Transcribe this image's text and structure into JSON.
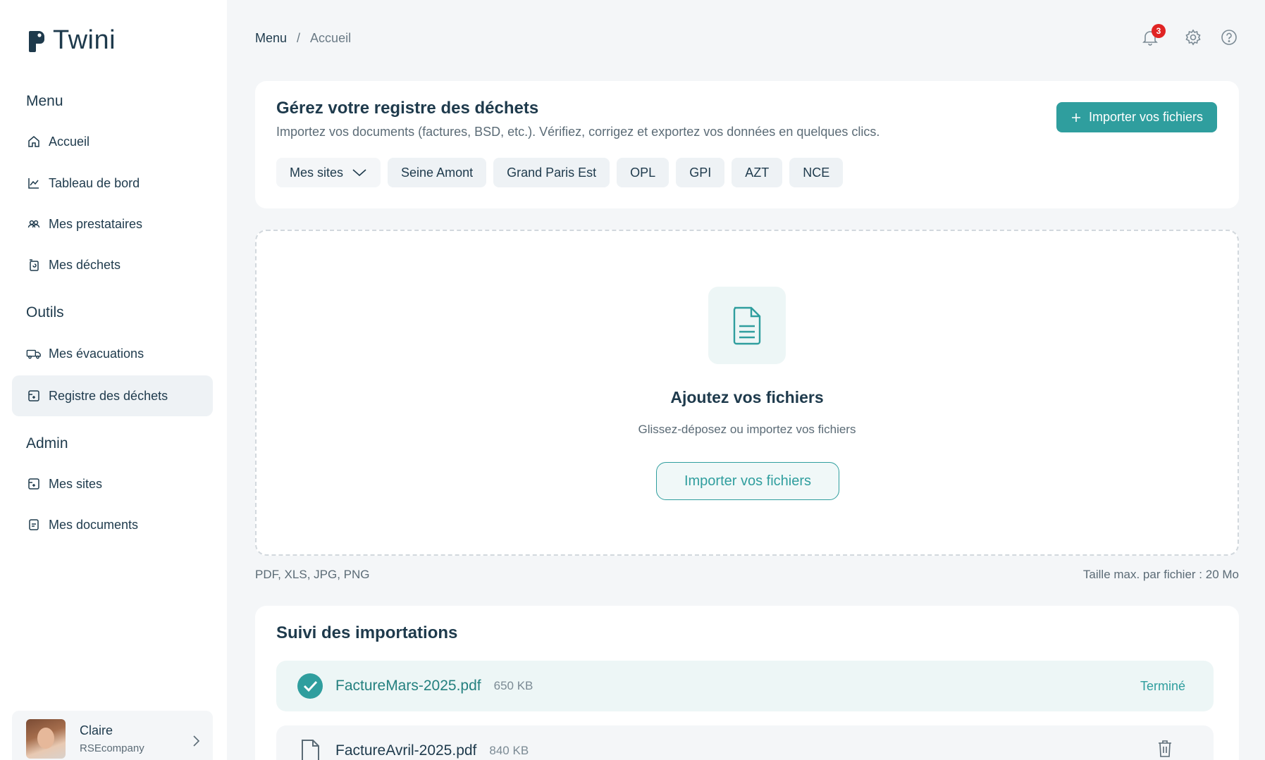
{
  "sidebar": {
    "brand": "Twini",
    "sections": {
      "menu": "Menu",
      "outils": "Outils",
      "admin": "Admin"
    },
    "items": [
      {
        "label": "Accueil",
        "icon": "home-icon"
      },
      {
        "label": "Tableau de bord",
        "icon": "chart-icon"
      },
      {
        "label": "Mes prestataires",
        "icon": "users-icon"
      },
      {
        "label": "Mes déchets",
        "icon": "recycle-icon"
      },
      {
        "label": "Mes évacuations",
        "icon": "truck-icon"
      },
      {
        "label": "Registre des déchets",
        "icon": "register-icon",
        "active": true
      },
      {
        "label": "Mes sites",
        "icon": "site-icon"
      },
      {
        "label": "Mes documents",
        "icon": "document-icon"
      }
    ],
    "user": {
      "name": "Claire",
      "company": "RSEcompany"
    }
  },
  "topbar": {
    "breadcrumb": {
      "root": "Menu",
      "separator": "/",
      "current": "Accueil"
    },
    "notifications_count": "3"
  },
  "header": {
    "title": "Gérez votre registre des déchets",
    "subtitle": "Importez vos documents (factures, BSD, etc.). Vérifiez, corrigez et exportez vos données en quelques clics.",
    "import_button": "Importer vos fichiers",
    "sites_dropdown": "Mes sites",
    "sites": [
      "Seine Amont",
      "Grand Paris Est",
      "OPL",
      "GPI",
      "AZT",
      "NCE"
    ]
  },
  "dropzone": {
    "title": "Ajoutez vos fichiers",
    "subtitle": "Glissez-déposez ou importez vos fichiers",
    "button": "Importer vos fichiers",
    "formats": "PDF, XLS, JPG, PNG",
    "max_size": "Taille max. par fichier : 20 Mo"
  },
  "imports": {
    "title": "Suivi des importations",
    "rows": [
      {
        "name": "FactureMars-2025.pdf",
        "size": "650 KB",
        "status": "Terminé"
      },
      {
        "name": "FactureAvril-2025.pdf",
        "size": "840 KB",
        "status": ""
      }
    ]
  },
  "colors": {
    "accent": "#2f9e9e",
    "text": "#1e3a4c",
    "muted": "#5b6b76",
    "badge": "#e02424"
  }
}
